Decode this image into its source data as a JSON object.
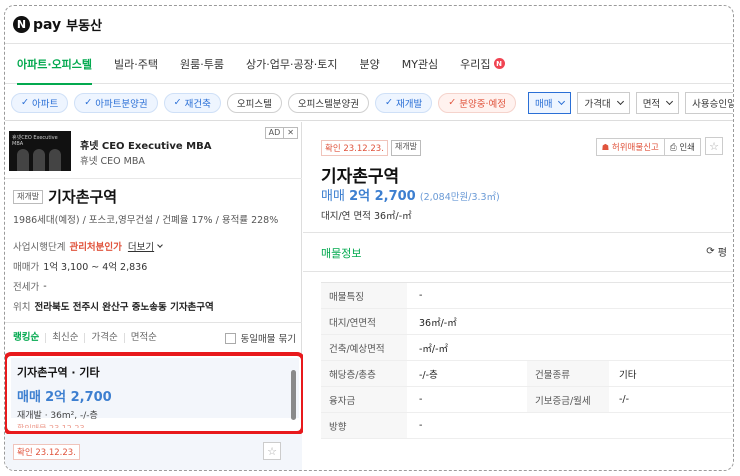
{
  "header": {
    "logo_mark": "N",
    "logo_pay": "pay",
    "logo_service": "부동산"
  },
  "tabs": [
    {
      "label": "아파트·오피스텔",
      "active": true
    },
    {
      "label": "빌라·주택"
    },
    {
      "label": "원룸·투룸"
    },
    {
      "label": "상가·업무·공장·토지"
    },
    {
      "label": "분양"
    },
    {
      "label": "MY관심"
    },
    {
      "label": "우리집",
      "badge": "N"
    }
  ],
  "filters": {
    "chips": [
      "아파트",
      "아파트분양권",
      "재건축",
      "오피스텔",
      "오피스텔분양권",
      "재개발",
      "분양중·예정"
    ],
    "dropdowns": [
      "매매",
      "가격대",
      "면적",
      "사용승인일"
    ]
  },
  "ad": {
    "badge": "AD",
    "close": "✕",
    "thumb_text": "휴넷CEO Executive MBA",
    "title": "휴넷 CEO Executive MBA",
    "subtitle": "휴넷 CEO MBA"
  },
  "complex": {
    "tag": "재개발",
    "name": "기자촌구역",
    "meta": "1986세대(예정) / 포스코,영무건설 / 건폐율 17% / 용적률 228%",
    "stage_label": "사업시행단계",
    "stage_value": "관리처분인가",
    "more": "더보기",
    "sale_label": "매매가",
    "sale_value": "1억 3,100 ~ 4억 2,836",
    "jeonse_label": "전세가",
    "jeonse_value": "-",
    "location_label": "위치",
    "location_value": "전라북도 전주시 완산구 중노송동 기자촌구역"
  },
  "sort": {
    "options": [
      "랭킹순",
      "최신순",
      "가격순",
      "면적순"
    ],
    "checkbox_label": "동일매물 묶기"
  },
  "listing": {
    "title": "기자촌구역 · 기타",
    "price_type": "매매",
    "price": "2억 2,700",
    "desc": "재개발 · 36m², -/-층",
    "truncated": "확인매물 23.12.23."
  },
  "listing2": {
    "confirm": "확인 23.12.23."
  },
  "detail": {
    "confirm": "확인 23.12.23.",
    "tag": "재개발",
    "report": "허위매물신고",
    "print": "인쇄",
    "title": "기자촌구역",
    "price_type": "매매",
    "price": "2억 2,700",
    "price_unit": "(2,084만원/3.3㎡)",
    "area_label": "대지/연 면적",
    "area_value": "36㎡/-㎡",
    "tab": "매물정보",
    "refresh": "평",
    "rows": [
      {
        "label": "매물특징",
        "value": "-"
      },
      {
        "label": "대지/연면적",
        "value": "36㎡/-㎡"
      },
      {
        "label": "건축/예상면적",
        "value": "-㎡/-㎡"
      },
      {
        "label": "해당층/총층",
        "value": "-/-층",
        "label2": "건물종류",
        "value2": "기타"
      },
      {
        "label": "융자금",
        "value": "-",
        "label2": "기보증금/월세",
        "value2": "-/-"
      },
      {
        "label": "방향",
        "value": "-"
      }
    ]
  }
}
